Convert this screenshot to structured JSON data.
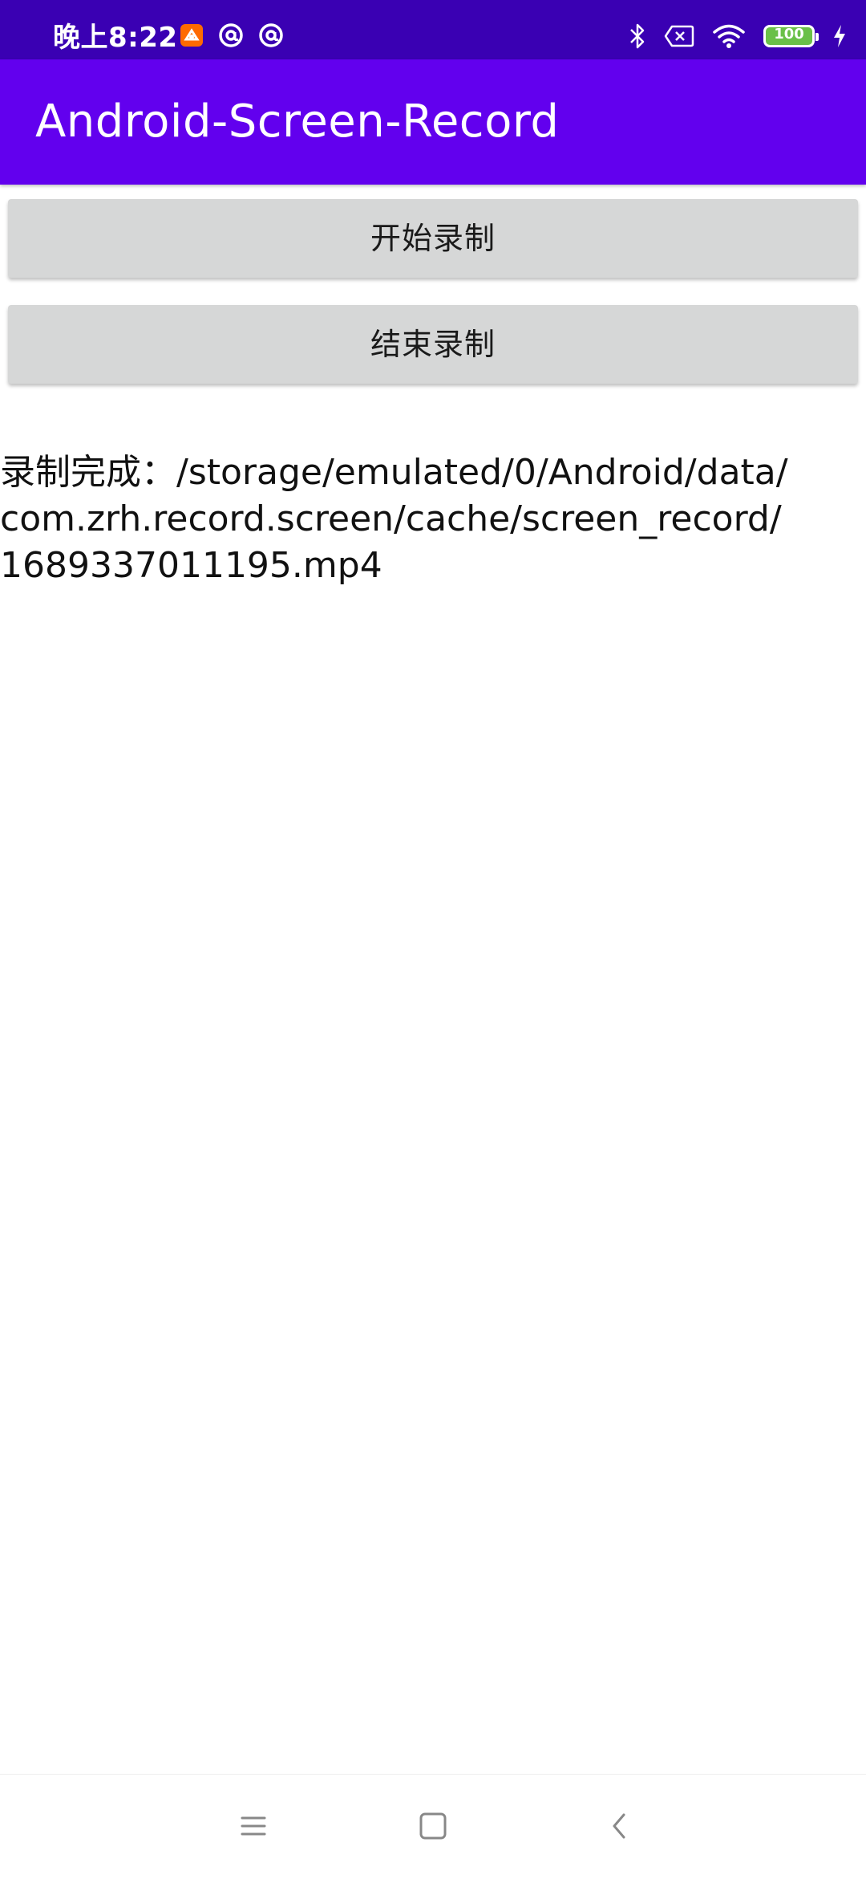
{
  "status_bar": {
    "time": "晚上8:22",
    "battery_level": "100",
    "icons": [
      "notification-app-icon",
      "at-sign-icon",
      "at-sign-icon",
      "bluetooth-icon",
      "no-sim-icon",
      "wifi-icon",
      "battery-icon",
      "charging-bolt-icon"
    ],
    "colors": {
      "background": "#3a00b3",
      "battery_fill": "#6ac048"
    }
  },
  "app_bar": {
    "title": "Android-Screen-Record",
    "color": "#6200ee"
  },
  "buttons": {
    "start_label": "开始录制",
    "stop_label": "结束录制"
  },
  "result": {
    "text": "录制完成：/storage/emulated/0/Android/data/\ncom.zrh.record.screen/cache/screen_record/\n1689337011195.mp4"
  },
  "nav_bar": {
    "icons": [
      "menu-icon",
      "home-icon",
      "back-icon"
    ]
  }
}
